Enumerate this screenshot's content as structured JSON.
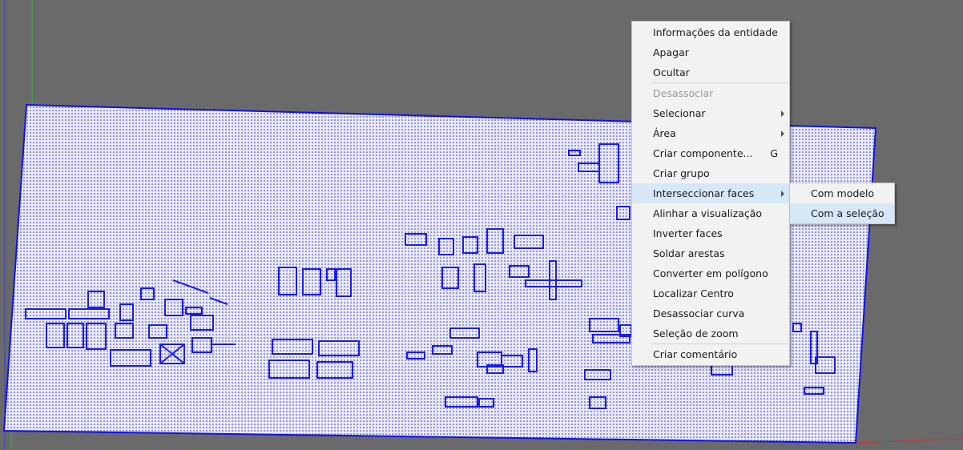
{
  "colors": {
    "background": "#6a6a6a",
    "plan_fill": "#e9e9f5",
    "plan_edge": "#1010ee",
    "menu_bg": "#f2f2f2",
    "menu_highlight": "#d6e8f7"
  },
  "context_menu": {
    "items": [
      {
        "label": "Informações da entidade"
      },
      {
        "label": "Apagar"
      },
      {
        "label": "Ocultar"
      },
      {
        "label": "Desassociar"
      },
      {
        "label": "Selecionar"
      },
      {
        "label": "Área"
      },
      {
        "label": "Criar componente...",
        "shortcut": "G"
      },
      {
        "label": "Criar grupo"
      },
      {
        "label": "Interseccionar faces"
      },
      {
        "label": "Alinhar a visualização"
      },
      {
        "label": "Inverter faces"
      },
      {
        "label": "Soldar arestas"
      },
      {
        "label": "Converter em polígono"
      },
      {
        "label": "Localizar Centro"
      },
      {
        "label": "Desassociar curva"
      },
      {
        "label": "Seleção de zoom"
      },
      {
        "label": "Criar comentário"
      }
    ]
  },
  "submenu": {
    "items": [
      {
        "label": "Com modelo"
      },
      {
        "label": "Com a seleção"
      }
    ]
  }
}
